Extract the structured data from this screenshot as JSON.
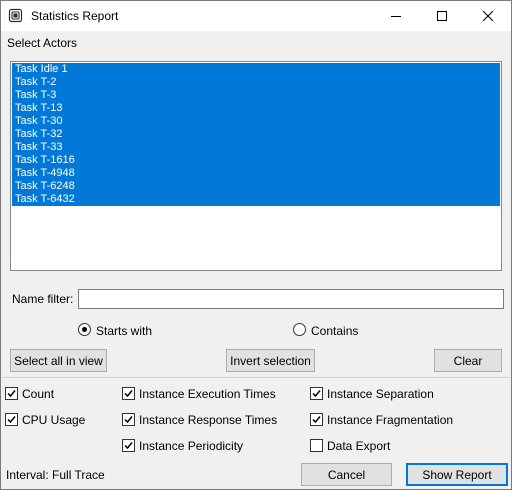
{
  "window": {
    "title": "Statistics Report",
    "icon": "statistics-app-icon",
    "controls": [
      "minimize-icon",
      "maximize-icon",
      "close-icon"
    ]
  },
  "select_actors_label": "Select Actors",
  "actors": [
    "Task Idle 1",
    "Task T-2",
    "Task T-3",
    "Task T-13",
    "Task T-30",
    "Task T-32",
    "Task T-33",
    "Task T-1616",
    "Task T-4948",
    "Task T-6248",
    "Task T-6432"
  ],
  "colors": {
    "selection": "#0078d7",
    "selection_text": "#ffffff",
    "window_bg": "#f0f0f0"
  },
  "name_filter": {
    "label": "Name filter:",
    "value": ""
  },
  "match_mode": {
    "starts_with": {
      "label": "Starts with",
      "checked": true
    },
    "contains": {
      "label": "Contains",
      "checked": false
    }
  },
  "buttons": {
    "select_all": "Select all in view",
    "invert": "Invert selection",
    "clear": "Clear",
    "cancel": "Cancel",
    "show_report": "Show Report"
  },
  "options": {
    "count": {
      "label": "Count",
      "checked": true
    },
    "cpu_usage": {
      "label": "CPU Usage",
      "checked": true
    },
    "execution_times": {
      "label": "Instance Execution Times",
      "checked": true
    },
    "response_times": {
      "label": "Instance Response Times",
      "checked": true
    },
    "periodicity": {
      "label": "Instance Periodicity",
      "checked": true
    },
    "separation": {
      "label": "Instance Separation",
      "checked": true
    },
    "fragmentation": {
      "label": "Instance Fragmentation",
      "checked": true
    },
    "data_export": {
      "label": "Data Export",
      "checked": false
    }
  },
  "interval": "Interval: Full Trace"
}
